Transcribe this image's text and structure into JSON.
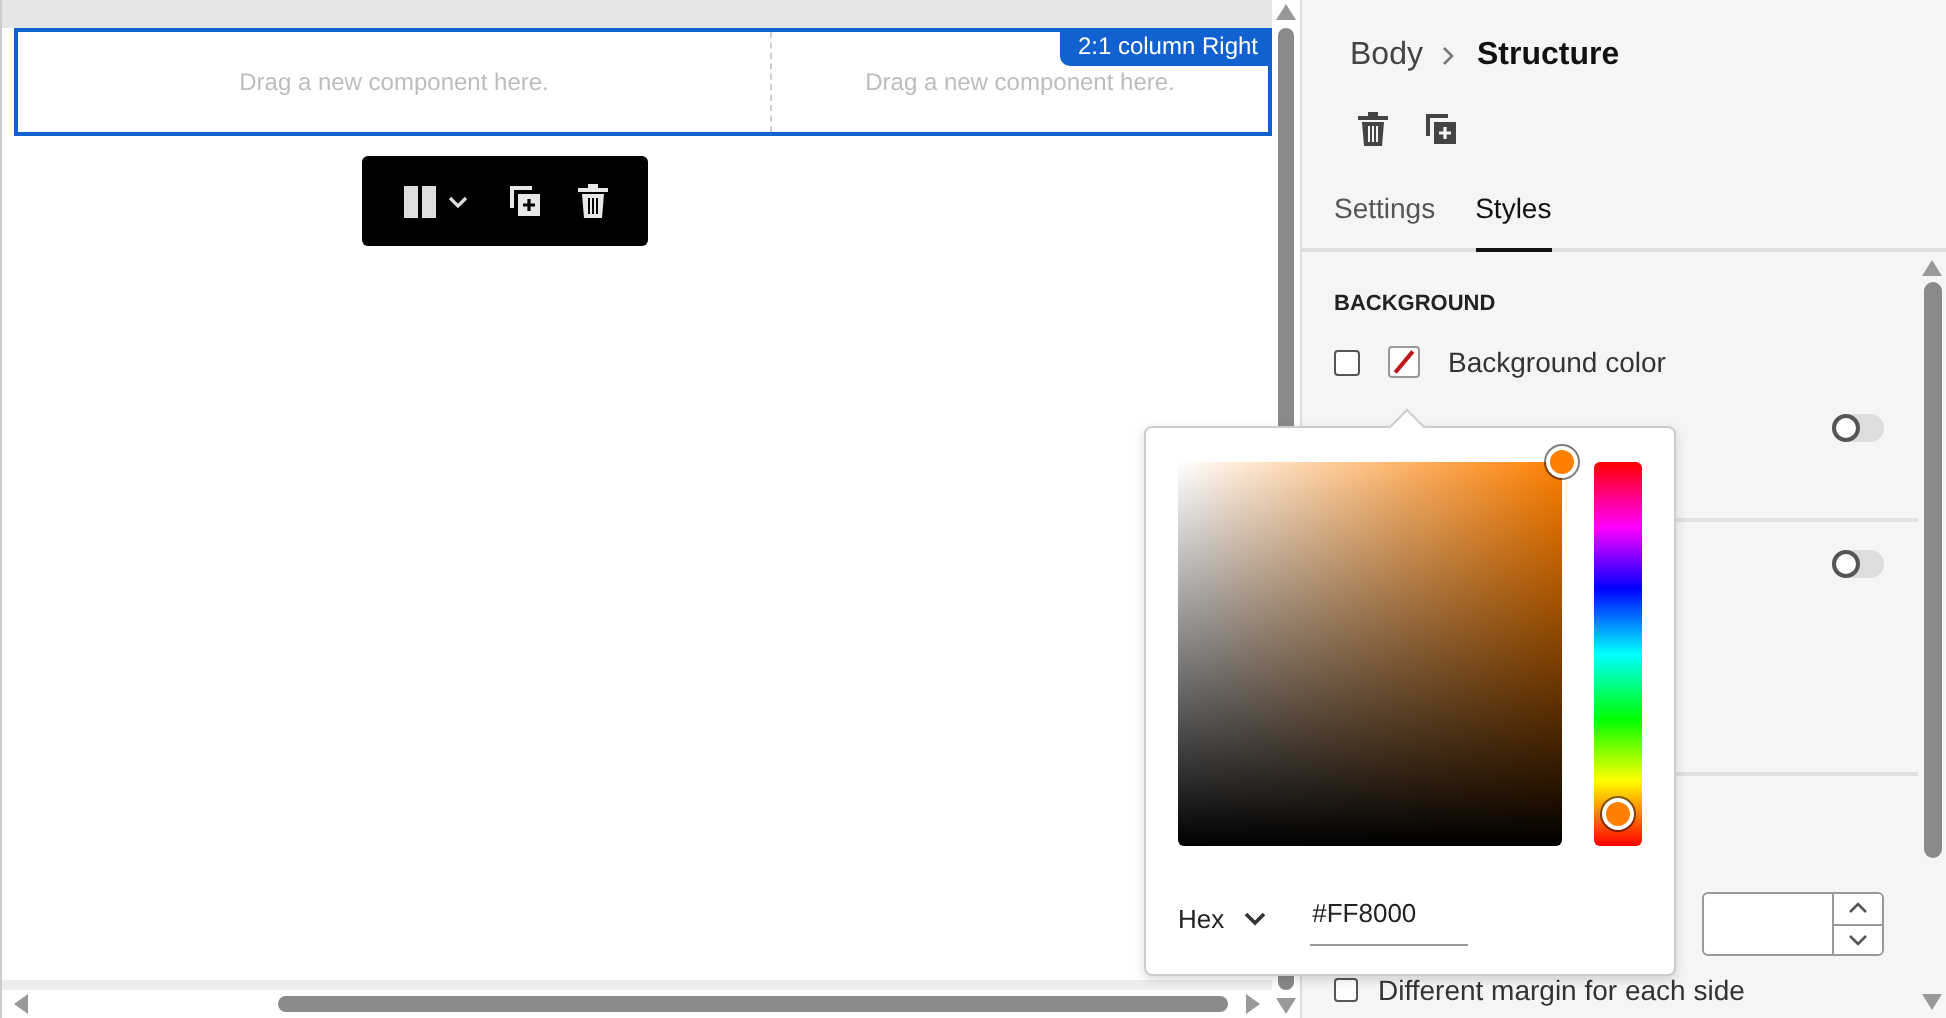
{
  "canvas": {
    "section_badge": "2:1 column Right",
    "columns": [
      {
        "placeholder": "Drag a new component here."
      },
      {
        "placeholder": "Drag a new component here."
      }
    ],
    "toolbar": [
      {
        "kind": "layout"
      },
      {
        "kind": "duplicate"
      },
      {
        "kind": "delete"
      }
    ]
  },
  "panel": {
    "breadcrumb": [
      "Body",
      "Structure"
    ],
    "actions": [
      {
        "kind": "delete"
      },
      {
        "kind": "duplicate"
      }
    ],
    "tabs": [
      {
        "label": "Settings",
        "selected": false
      },
      {
        "label": "Styles",
        "selected": true
      }
    ],
    "section_title": "BACKGROUND",
    "background_color": {
      "label": "Background color",
      "checked": false
    },
    "toggles": [
      {
        "on": false
      },
      {
        "on": false
      }
    ],
    "margin_checkbox": {
      "label": "Different margin for each side",
      "checked": false
    }
  },
  "color_picker": {
    "format": "Hex",
    "value": "#FF8000",
    "hue": {
      "level": 0.083
    }
  }
}
